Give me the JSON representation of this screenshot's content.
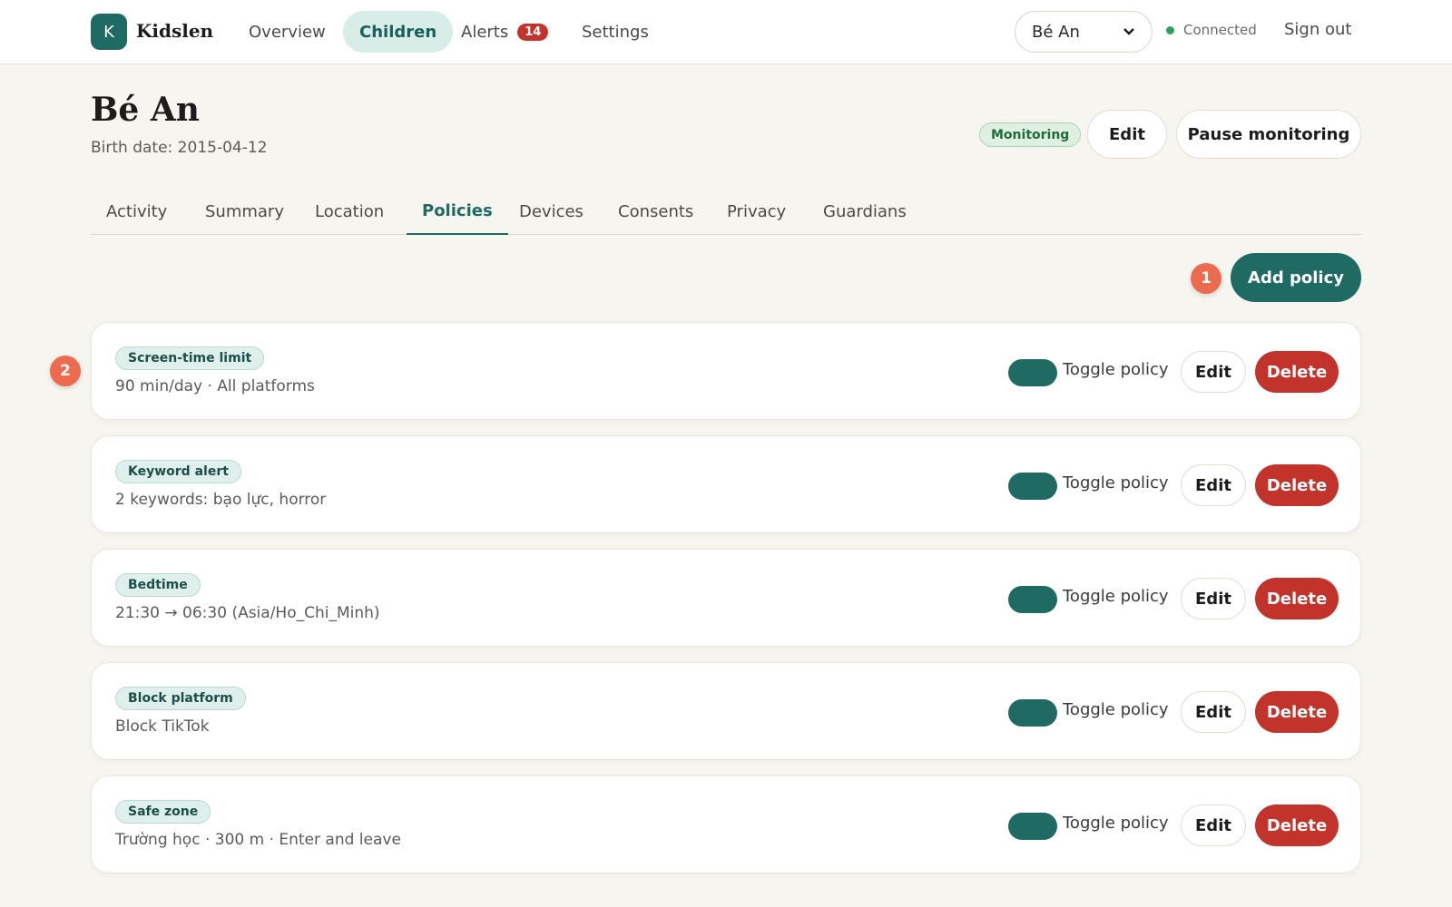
{
  "app": {
    "logo_letter": "K",
    "name": "Kidslen"
  },
  "nav": {
    "overview": "Overview",
    "children": "Children",
    "alerts": "Alerts",
    "alerts_count": "14",
    "settings": "Settings"
  },
  "topbar": {
    "selected_child": "Bé An",
    "connection_status": "Connected",
    "sign_out": "Sign out"
  },
  "child": {
    "name": "Bé An",
    "birth_date": "Birth date: 2015-04-12",
    "status": "Monitoring",
    "edit_label": "Edit",
    "pause_label": "Pause monitoring"
  },
  "tabs": [
    "Activity",
    "Summary",
    "Location",
    "Policies",
    "Devices",
    "Consents",
    "Privacy",
    "Guardians"
  ],
  "active_tab": "Policies",
  "add_policy_label": "Add policy",
  "markers": {
    "m1": "1",
    "m2": "2"
  },
  "policy_actions": {
    "toggle_label": "Toggle policy",
    "edit": "Edit",
    "delete": "Delete"
  },
  "policies": [
    {
      "type": "Screen-time limit",
      "description": "90 min/day · All platforms",
      "enabled": true
    },
    {
      "type": "Keyword alert",
      "description": "2 keywords: bạo lực, horror",
      "enabled": true
    },
    {
      "type": "Bedtime",
      "description": "21:30 → 06:30 (Asia/Ho_Chi_Minh)",
      "enabled": true
    },
    {
      "type": "Block platform",
      "description": "Block TikTok",
      "enabled": true
    },
    {
      "type": "Safe zone",
      "description": "Trường học · 300 m · Enter and leave",
      "enabled": true
    }
  ],
  "colors": {
    "brand": "#1f6b63",
    "danger": "#c2332c",
    "marker": "#ec6b4e",
    "background": "#f7f5ef"
  }
}
